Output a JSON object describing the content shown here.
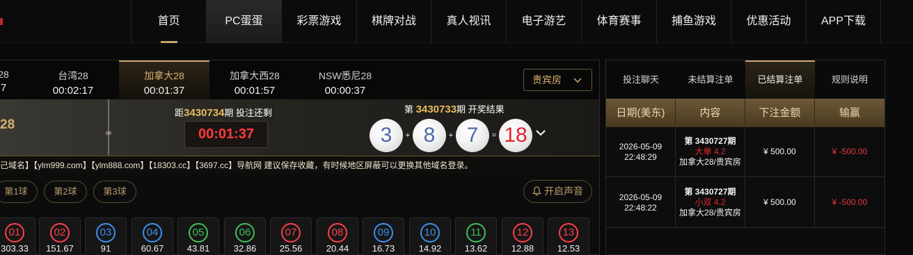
{
  "nav": {
    "items": [
      "首页",
      "PC蛋蛋",
      "彩票游戏",
      "棋牌对战",
      "真人视讯",
      "电子游艺",
      "体育赛事",
      "捕鱼游戏",
      "优惠活动",
      "APP下载"
    ]
  },
  "lottery_tabs": [
    {
      "name": "28",
      "time": "7"
    },
    {
      "name": "台湾28",
      "time": "00:02:17"
    },
    {
      "name": "加拿大28",
      "time": "00:01:37"
    },
    {
      "name": "加拿大西28",
      "time": "00:01:57"
    },
    {
      "name": "NSW悉尼28",
      "time": "00:00:37"
    }
  ],
  "room_select": {
    "value": "贵宾房"
  },
  "draw": {
    "current_name_fragment": "28",
    "countdown_prefix": "距",
    "countdown_issue": "3430734",
    "countdown_suffix": "期 投注还剩",
    "countdown": "00:01:37",
    "result_prefix": "第",
    "result_issue": "3430733",
    "result_suffix": "期 开奖结果",
    "balls": [
      "3",
      "8",
      "7"
    ],
    "ops": [
      "+",
      "+",
      "="
    ],
    "sum": "18"
  },
  "notice": "己域名】【ylm999.com】【ylm888.com】【18303.cc】【3697.cc】导航网 建议保存收藏，有时候地区屏蔽可以更换其他域名登录。",
  "ball_tabs": [
    "第1球",
    "第2球",
    "第3球"
  ],
  "sound_button": "开启声音",
  "numbers": [
    {
      "num": "01",
      "odds": "303.33",
      "color": "red"
    },
    {
      "num": "02",
      "odds": "151.67",
      "color": "red"
    },
    {
      "num": "03",
      "odds": "91",
      "color": "blue"
    },
    {
      "num": "04",
      "odds": "60.67",
      "color": "blue"
    },
    {
      "num": "05",
      "odds": "43.81",
      "color": "green"
    },
    {
      "num": "06",
      "odds": "32.86",
      "color": "green"
    },
    {
      "num": "07",
      "odds": "25.56",
      "color": "red"
    },
    {
      "num": "08",
      "odds": "20.44",
      "color": "red"
    },
    {
      "num": "09",
      "odds": "16.73",
      "color": "blue"
    },
    {
      "num": "10",
      "odds": "14.92",
      "color": "blue"
    },
    {
      "num": "11",
      "odds": "13.62",
      "color": "green"
    },
    {
      "num": "12",
      "odds": "12.88",
      "color": "red"
    },
    {
      "num": "13",
      "odds": "12.53",
      "color": "red"
    }
  ],
  "right_tabs": [
    "投注聊天",
    "未结算注单",
    "已结算注单",
    "规则说明"
  ],
  "table": {
    "headers": [
      "日期(美东)",
      "内容",
      "下注金额",
      "输赢"
    ],
    "rows": [
      {
        "date": "2026-05-09",
        "time": "22:48:29",
        "issue": "第 3430727期",
        "pick": "大单 4.2",
        "room": "加拿大28/贵宾房",
        "amount": "¥ 500.00",
        "result": "¥ -500.00"
      },
      {
        "date": "2026-05-09",
        "time": "22:48:22",
        "issue": "第 3430727期",
        "pick": "小双 4.2",
        "room": "加拿大28/贵宾房",
        "amount": "¥ 500.00",
        "result": "¥ -500.00"
      }
    ]
  },
  "colors": {
    "accent_gold": "#c8a46a",
    "countdown_red": "#ff3b3b",
    "loss_red": "#e33a3a"
  }
}
